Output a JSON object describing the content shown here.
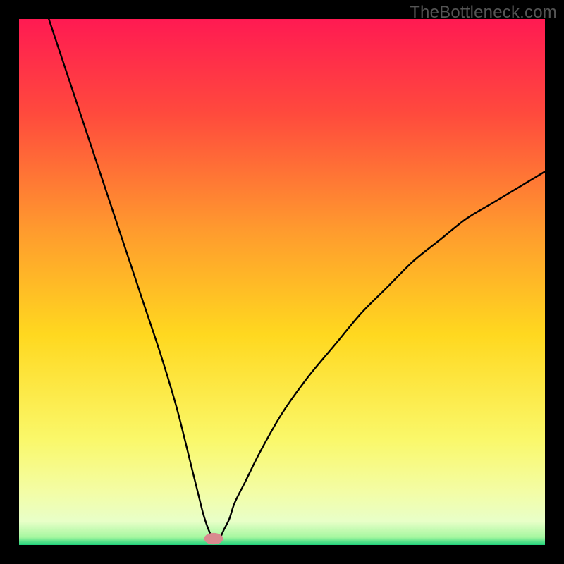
{
  "watermark": "TheBottleneck.com",
  "chart_data": {
    "type": "line",
    "title": "",
    "xlabel": "",
    "ylabel": "",
    "xlim": [
      0,
      100
    ],
    "ylim": [
      0,
      100
    ],
    "minimum_x": 37,
    "background_gradient": {
      "stops": [
        {
          "offset": 0,
          "color": "#ff1a52"
        },
        {
          "offset": 0.18,
          "color": "#ff4a3d"
        },
        {
          "offset": 0.4,
          "color": "#ff9a2e"
        },
        {
          "offset": 0.6,
          "color": "#ffd81f"
        },
        {
          "offset": 0.8,
          "color": "#faf86a"
        },
        {
          "offset": 0.9,
          "color": "#f3fda6"
        },
        {
          "offset": 0.955,
          "color": "#e8ffc8"
        },
        {
          "offset": 0.985,
          "color": "#a6f7a0"
        },
        {
          "offset": 1.0,
          "color": "#1fd17a"
        }
      ]
    },
    "curve": {
      "x": [
        0,
        3,
        6,
        9,
        12,
        15,
        18,
        21,
        24,
        27,
        30,
        33,
        34,
        35,
        36,
        37,
        38,
        39,
        40,
        41,
        43,
        46,
        50,
        55,
        60,
        65,
        70,
        75,
        80,
        85,
        90,
        95,
        100
      ],
      "y": [
        117,
        108,
        99,
        90,
        81,
        72,
        63,
        54,
        45,
        36,
        26,
        14,
        10,
        6,
        3,
        1,
        1,
        3,
        5,
        8,
        12,
        18,
        25,
        32,
        38,
        44,
        49,
        54,
        58,
        62,
        65,
        68,
        71
      ]
    },
    "marker": {
      "x": 37,
      "y": 1.2,
      "rx": 1.8,
      "ry": 1.1,
      "color": "#d98a8f"
    },
    "grid": false,
    "legend": false
  }
}
